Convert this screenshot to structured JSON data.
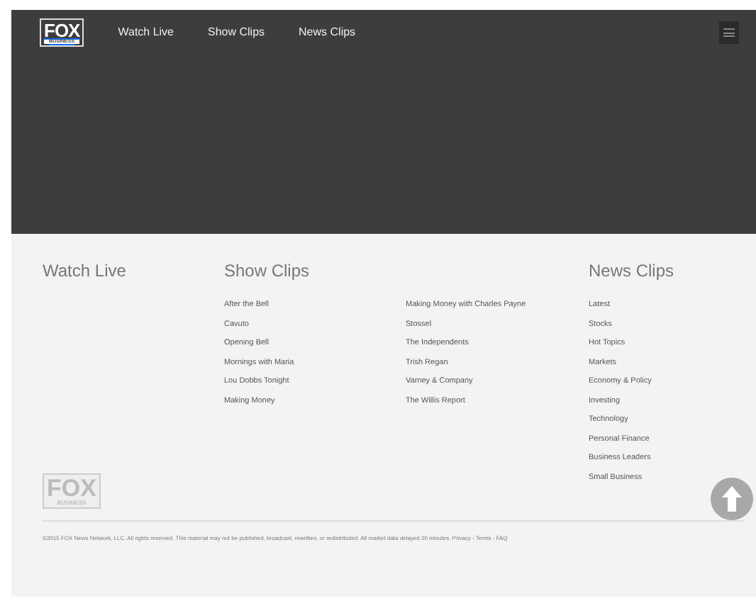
{
  "navbar": {
    "logo": {
      "main": "FOX",
      "sub": "BUSINESS"
    },
    "links": [
      {
        "label": "Watch Live"
      },
      {
        "label": "Show Clips"
      },
      {
        "label": "News Clips"
      }
    ]
  },
  "footer": {
    "watch_live": {
      "heading": "Watch Live"
    },
    "show_clips": {
      "heading": "Show Clips",
      "columns": [
        [
          "After the Bell",
          "Cavuto",
          "Opening Bell",
          "Mornings with Maria",
          "Lou Dobbs Tonight",
          "Making Money"
        ],
        [
          "Making Money with Charles Payne",
          "Stossel",
          "The Independents",
          "Trish Regan",
          "Varney & Company",
          "The Willis Report"
        ]
      ]
    },
    "news_clips": {
      "heading": "News Clips",
      "items": [
        "Latest",
        "Stocks",
        "Hot Topics",
        "Markets",
        "Economy & Policy",
        "Investing",
        "Technology",
        "Personal Finance",
        "Business Leaders",
        "Small Business"
      ]
    },
    "logo": {
      "main": "FOX",
      "sub": "BUSINESS"
    },
    "copyright": "©2015 FOX News Network, LLC. All rights reserved. This material may not be published, broadcast, rewritten, or redistributed. All market data delayed 20 minutes. Privacy - Terms - FAQ"
  }
}
